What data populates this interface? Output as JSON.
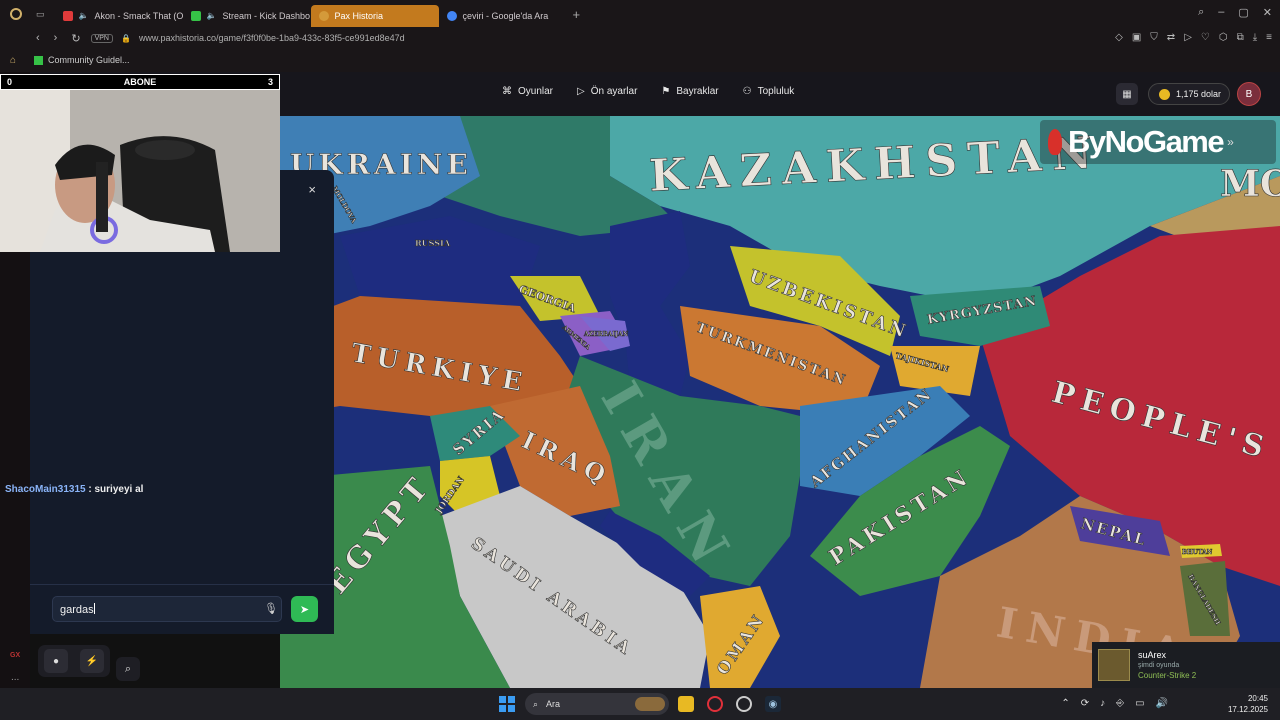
{
  "browser": {
    "tabs": [
      {
        "label": "Akon - Smack That (O",
        "favicon_color": "#e03b3b",
        "active": false
      },
      {
        "label": "Stream - Kick Dashbo",
        "favicon_color": "#36c247",
        "active": false
      },
      {
        "label": "Pax Historia",
        "favicon_color": "#d49a3a",
        "active": true
      },
      {
        "label": "çeviri - Google'da Ara",
        "favicon_color": "#4285f4",
        "active": false
      }
    ],
    "new_tab": "+",
    "vpn": "VPN",
    "url": "www.paxhistoria.co/game/f3f0f0be-1ba9-433c-83f5-ce991ed8e47d",
    "bookmark": "Community Guidel..."
  },
  "header": {
    "menu": [
      {
        "label": "Oyunlar",
        "icon": "gamepad-icon"
      },
      {
        "label": "Ön ayarlar",
        "icon": "play-icon"
      },
      {
        "label": "Bayraklar",
        "icon": "flag-icon"
      },
      {
        "label": "Topluluk",
        "icon": "users-icon"
      }
    ],
    "coins": "1,175 dolar",
    "avatar_letter": "B"
  },
  "overlay": {
    "abone_left": "0",
    "abone_label": "ABONE",
    "abone_right": "3",
    "logo_text": "ByNoGame",
    "logo_suffix": "»"
  },
  "map": {
    "labels": [
      {
        "text": "UKRAINE"
      },
      {
        "text": "KAZAKHSTAN"
      },
      {
        "text": "MO"
      },
      {
        "text": "RUSSIA"
      },
      {
        "text": "GEORGIA"
      },
      {
        "text": "ARMENIA"
      },
      {
        "text": "AZERBAIJAN"
      },
      {
        "text": "UZBEKISTAN"
      },
      {
        "text": "KYRGYZSTAN"
      },
      {
        "text": "TURKMENISTAN"
      },
      {
        "text": "TAJIKISTAN"
      },
      {
        "text": "TURKIYE"
      },
      {
        "text": "PEOPLE'S"
      },
      {
        "text": "SYRIA"
      },
      {
        "text": "IRAN"
      },
      {
        "text": "IRAQ"
      },
      {
        "text": "AFGHANISTAN"
      },
      {
        "text": "JORDAN"
      },
      {
        "text": "PAKISTAN"
      },
      {
        "text": "NEPAL"
      },
      {
        "text": "BHUTAN"
      },
      {
        "text": "BANGLADESH"
      },
      {
        "text": "INDIA"
      },
      {
        "text": "SAUDI ARABIA"
      },
      {
        "text": "OMAN"
      },
      {
        "text": "EGYPT"
      },
      {
        "text": "MOLDOVA"
      }
    ]
  },
  "chat": {
    "close": "×",
    "messages": [
      {
        "user": "ShacoMain31315",
        "sep": " : ",
        "text": "suriyeyi al"
      }
    ],
    "input_value": "gardas"
  },
  "notification": {
    "name": "suArex",
    "status": "şimdi oyunda",
    "game": "Counter-Strike 2"
  },
  "taskbar": {
    "search_label": "Ara",
    "time": "20:45",
    "date": "17.12.2025"
  },
  "sidebar": {
    "gx": "GX",
    "more": "..."
  }
}
